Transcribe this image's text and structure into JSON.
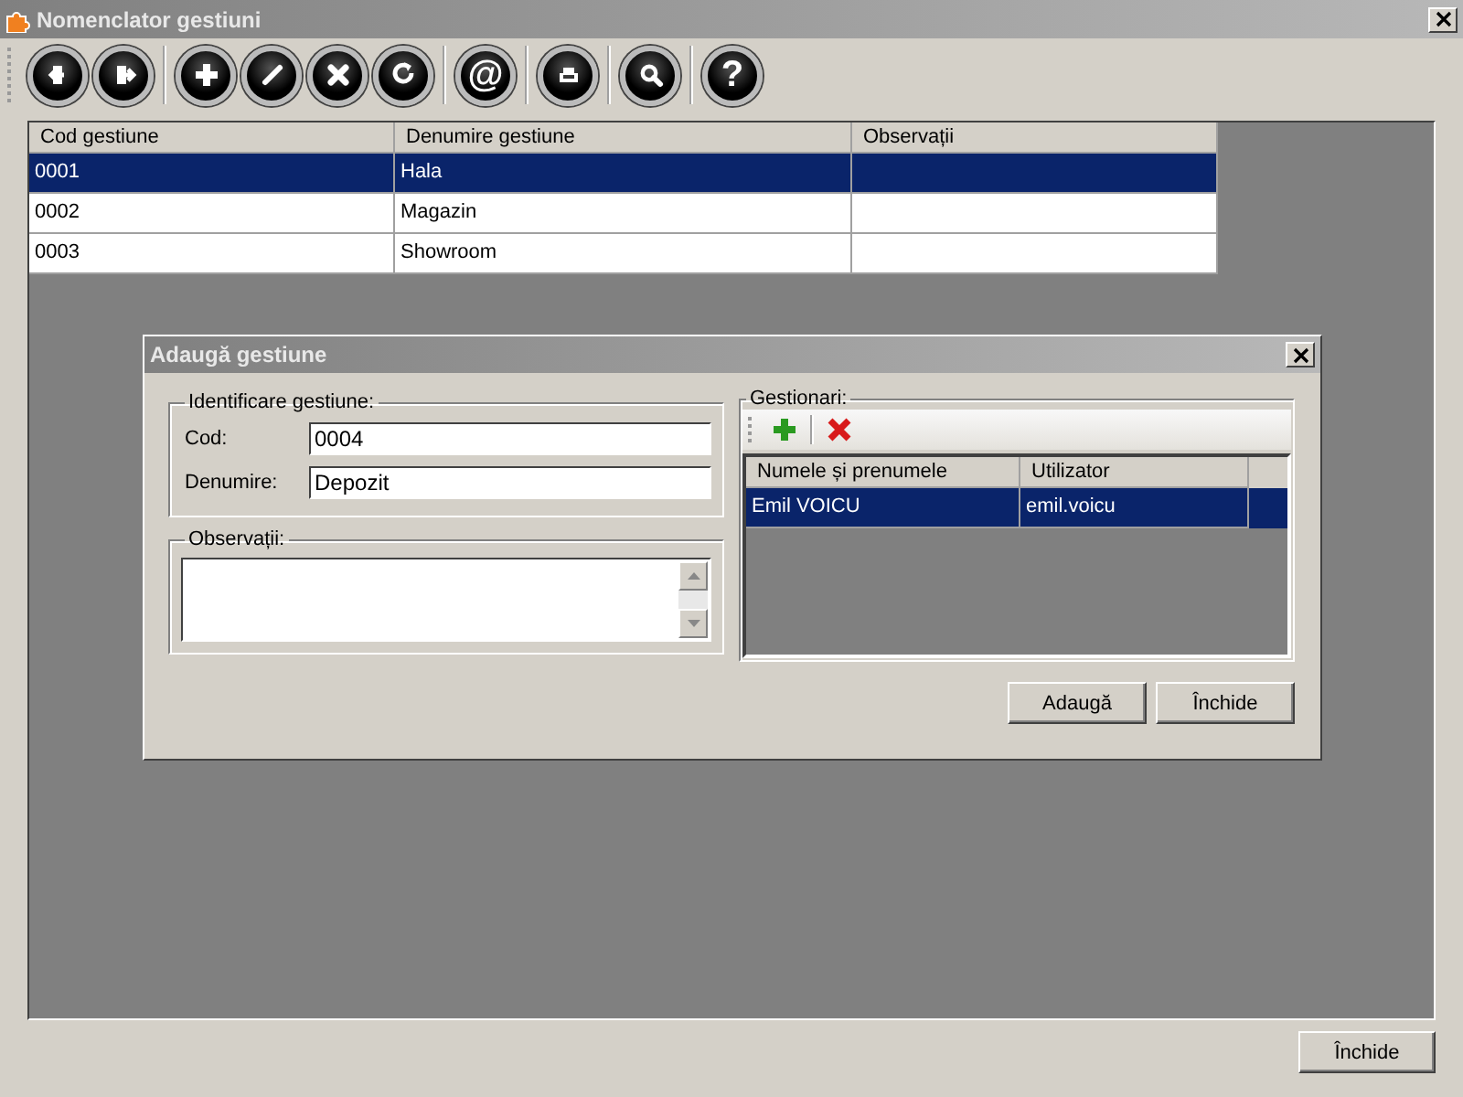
{
  "window": {
    "title": "Nomenclator gestiuni"
  },
  "toolbar": [
    {
      "kind": "back"
    },
    {
      "kind": "exit"
    },
    {
      "kind": "sep"
    },
    {
      "kind": "add"
    },
    {
      "kind": "edit"
    },
    {
      "kind": "delete"
    },
    {
      "kind": "refresh"
    },
    {
      "kind": "sep"
    },
    {
      "kind": "glyph",
      "glyph": "@"
    },
    {
      "kind": "sep"
    },
    {
      "kind": "print"
    },
    {
      "kind": "sep"
    },
    {
      "kind": "search"
    },
    {
      "kind": "sep"
    },
    {
      "kind": "glyph",
      "glyph": "?"
    }
  ],
  "table": {
    "columns": [
      "Cod gestiune",
      "Denumire gestiune",
      "Observații"
    ],
    "rows": [
      {
        "cells": [
          "0001",
          "Hala",
          ""
        ],
        "selected": true
      },
      {
        "cells": [
          "0002",
          "Magazin",
          ""
        ],
        "selected": false
      },
      {
        "cells": [
          "0003",
          "Showroom",
          ""
        ],
        "selected": false
      }
    ]
  },
  "dialog": {
    "title": "Adaugă gestiune",
    "identification": {
      "legend": "Identificare gestiune:",
      "fields": [
        {
          "label": "Cod:",
          "value": "0004"
        },
        {
          "label": "Denumire:",
          "value": "Depozit"
        }
      ]
    },
    "notes": {
      "legend": "Observații:"
    },
    "managers": {
      "legend": "Gestionari:",
      "columns": [
        "Numele și prenumele",
        "Utilizator"
      ],
      "rows": [
        {
          "cells": [
            "Emil VOICU",
            "emil.voicu"
          ],
          "selected": true
        }
      ]
    },
    "buttons": [
      "Adaugă",
      "Închide"
    ]
  },
  "footer_button": "Închide"
}
